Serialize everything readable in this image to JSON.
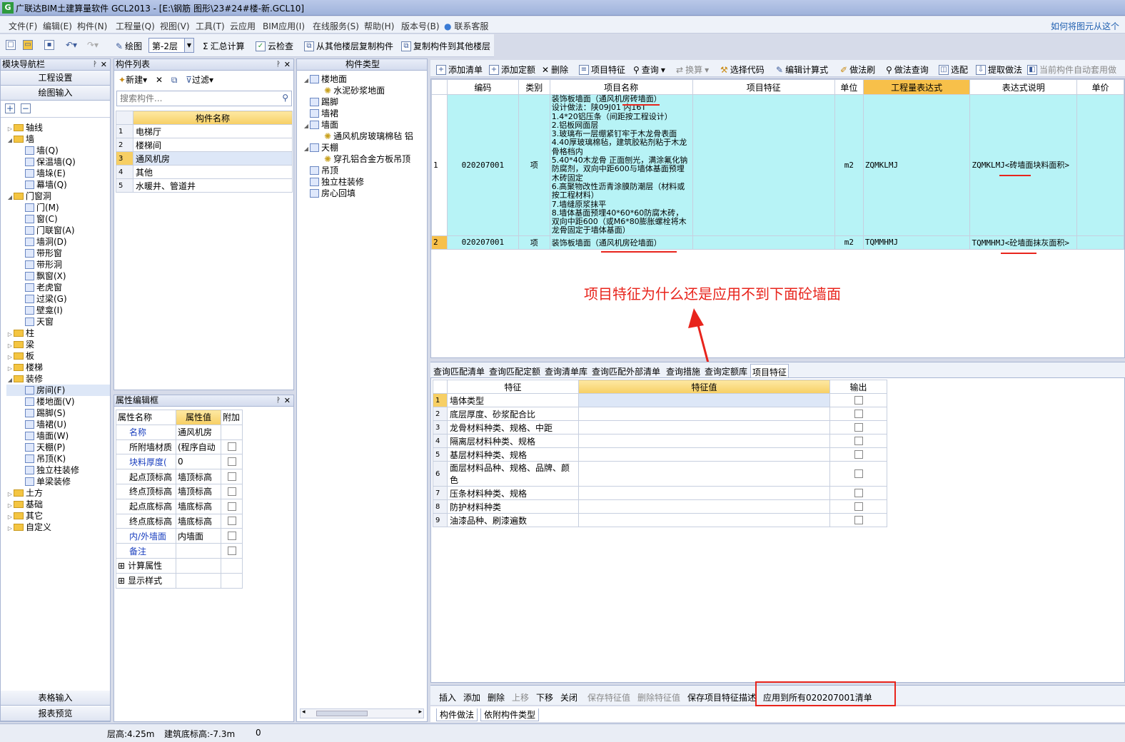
{
  "window": {
    "title": "广联达BIM土建算量软件 GCL2013 - [E:\\钢筋 图形\\23#24#楼-新.GCL10]",
    "app_icon_letter": "G"
  },
  "menu": {
    "items": [
      "文件(F)",
      "编辑(E)",
      "构件(N)",
      "工程量(Q)",
      "视图(V)",
      "工具(T)",
      "云应用",
      "BIM应用(I)",
      "在线服务(S)",
      "帮助(H)",
      "版本号(B)",
      "联系客服"
    ],
    "help_link": "如何将图元从这个"
  },
  "toolbar": {
    "draw": "绘图",
    "floor": "第-2层",
    "sum_calc": "汇总计算",
    "cloud_check": "云检查",
    "copy_from_floor": "从其他楼层复制构件",
    "copy_to_floor": "复制构件到其他楼层"
  },
  "nav": {
    "title": "模块导航栏",
    "buttons": {
      "project_settings": "工程设置",
      "draw_input": "绘图输入",
      "table_input": "表格输入",
      "report_preview": "报表预览"
    },
    "tree": [
      {
        "label": "轴线",
        "level": 0,
        "type": "folder",
        "exp": "+"
      },
      {
        "label": "墙",
        "level": 0,
        "type": "folder",
        "exp": "-"
      },
      {
        "label": "墙(Q)",
        "level": 1,
        "type": "leaf"
      },
      {
        "label": "保温墙(Q)",
        "level": 1,
        "type": "leaf"
      },
      {
        "label": "墙垛(E)",
        "level": 1,
        "type": "leaf"
      },
      {
        "label": "幕墙(Q)",
        "level": 1,
        "type": "leaf"
      },
      {
        "label": "门窗洞",
        "level": 0,
        "type": "folder",
        "exp": "-"
      },
      {
        "label": "门(M)",
        "level": 1,
        "type": "leaf"
      },
      {
        "label": "窗(C)",
        "level": 1,
        "type": "leaf"
      },
      {
        "label": "门联窗(A)",
        "level": 1,
        "type": "leaf"
      },
      {
        "label": "墙洞(D)",
        "level": 1,
        "type": "leaf"
      },
      {
        "label": "带形窗",
        "level": 1,
        "type": "leaf"
      },
      {
        "label": "带形洞",
        "level": 1,
        "type": "leaf"
      },
      {
        "label": "飘窗(X)",
        "level": 1,
        "type": "leaf"
      },
      {
        "label": "老虎窗",
        "level": 1,
        "type": "leaf"
      },
      {
        "label": "过梁(G)",
        "level": 1,
        "type": "leaf"
      },
      {
        "label": "壁龛(I)",
        "level": 1,
        "type": "leaf"
      },
      {
        "label": "天窗",
        "level": 1,
        "type": "leaf"
      },
      {
        "label": "柱",
        "level": 0,
        "type": "folder",
        "exp": "+"
      },
      {
        "label": "梁",
        "level": 0,
        "type": "folder",
        "exp": "+"
      },
      {
        "label": "板",
        "level": 0,
        "type": "folder",
        "exp": "+"
      },
      {
        "label": "楼梯",
        "level": 0,
        "type": "folder",
        "exp": "+"
      },
      {
        "label": "装修",
        "level": 0,
        "type": "folder",
        "exp": "-"
      },
      {
        "label": "房间(F)",
        "level": 1,
        "type": "leaf",
        "selected": true
      },
      {
        "label": "楼地面(V)",
        "level": 1,
        "type": "leaf"
      },
      {
        "label": "踢脚(S)",
        "level": 1,
        "type": "leaf"
      },
      {
        "label": "墙裙(U)",
        "level": 1,
        "type": "leaf"
      },
      {
        "label": "墙面(W)",
        "level": 1,
        "type": "leaf"
      },
      {
        "label": "天棚(P)",
        "level": 1,
        "type": "leaf"
      },
      {
        "label": "吊顶(K)",
        "level": 1,
        "type": "leaf"
      },
      {
        "label": "独立柱装修",
        "level": 1,
        "type": "leaf"
      },
      {
        "label": "单梁装修",
        "level": 1,
        "type": "leaf"
      },
      {
        "label": "土方",
        "level": 0,
        "type": "folder",
        "exp": "+"
      },
      {
        "label": "基础",
        "level": 0,
        "type": "folder",
        "exp": "+"
      },
      {
        "label": "其它",
        "level": 0,
        "type": "folder",
        "exp": "+"
      },
      {
        "label": "自定义",
        "level": 0,
        "type": "folder",
        "exp": "+"
      }
    ]
  },
  "component_list": {
    "title": "构件列表",
    "new": "新建",
    "filter": "过滤",
    "search_placeholder": "搜索构件...",
    "header": "构件名称",
    "rows": [
      {
        "n": "1",
        "name": "电梯厅"
      },
      {
        "n": "2",
        "name": "楼梯间"
      },
      {
        "n": "3",
        "name": "通风机房"
      },
      {
        "n": "4",
        "name": "其他"
      },
      {
        "n": "5",
        "name": "水暖井、管道井"
      }
    ]
  },
  "properties": {
    "title": "属性编辑框",
    "headers": [
      "属性名称",
      "属性值",
      "附加"
    ],
    "rows": [
      {
        "name": "名称",
        "value": "通风机房",
        "blue": true,
        "check": false
      },
      {
        "name": "所附墙材质",
        "value": "(程序自动",
        "blue": false,
        "check": true
      },
      {
        "name": "块料厚度(",
        "value": "0",
        "blue": true,
        "check": true
      },
      {
        "name": "起点顶标高",
        "value": "墙顶标高",
        "blue": false,
        "check": true
      },
      {
        "name": "终点顶标高",
        "value": "墙顶标高",
        "blue": false,
        "check": true
      },
      {
        "name": "起点底标高",
        "value": "墙底标高",
        "blue": false,
        "check": true
      },
      {
        "name": "终点底标高",
        "value": "墙底标高",
        "blue": false,
        "check": true
      },
      {
        "name": "内/外墙面",
        "value": "内墙面",
        "blue": true,
        "check": true
      },
      {
        "name": "备注",
        "value": "",
        "blue": true,
        "check": true
      },
      {
        "name": "计算属性",
        "value": "",
        "blue": false,
        "check": false,
        "expander": true
      },
      {
        "name": "显示样式",
        "value": "",
        "blue": false,
        "check": false,
        "expander": true
      }
    ]
  },
  "component_types": {
    "title": "构件类型",
    "tree": [
      {
        "label": "楼地面",
        "level": 0
      },
      {
        "label": "水泥砂浆地面",
        "level": 1
      },
      {
        "label": "踢脚",
        "level": 0
      },
      {
        "label": "墙裙",
        "level": 0
      },
      {
        "label": "墙面",
        "level": 0
      },
      {
        "label": "通风机房玻璃棉毡 铝",
        "level": 1
      },
      {
        "label": "天棚",
        "level": 0
      },
      {
        "label": "穿孔铝合金方板吊顶",
        "level": 1
      },
      {
        "label": "吊顶",
        "level": 0
      },
      {
        "label": "独立柱装修",
        "level": 0
      },
      {
        "label": "房心回填",
        "level": 0
      }
    ]
  },
  "main_toolbar": [
    "添加清单",
    "添加定额",
    "删除",
    "项目特征",
    "查询",
    "换算",
    "选择代码",
    "编辑计算式",
    "做法刷",
    "做法查询",
    "选配",
    "提取做法",
    "当前构件自动套用做"
  ],
  "bill": {
    "headers": [
      "编码",
      "类别",
      "项目名称",
      "项目特征",
      "单位",
      "工程量表达式",
      "表达式说明",
      "单价"
    ],
    "rows": [
      {
        "n": "1",
        "code": "020207001",
        "kind": "项",
        "name": "装饰板墙面（通风机房砖墙面）\n设计做法：陕09J01 内16T\n1.4*20铝压条（间距按工程设计）\n2.铝板网面层\n3.玻璃布一层绷紧钉牢于木龙骨表面\n4.40厚玻璃棉毡，建筑胶粘剂粘于木龙骨格档内\n5.40*40木龙骨 正面刨光，满涂氟化钠防腐剂，双向中距600与墙体基面预埋木砖固定\n6.高聚物改性沥青涂膜防潮层（材料或按工程材料）\n7.墙缝原浆抹平\n8.墙体基面预埋40*60*60防腐木砖，双向中距600（或M6*80膨胀螺栓将木龙骨固定于墙体基面）",
        "feature": "",
        "unit": "m2",
        "expr": "ZQMKLMJ",
        "expr_desc": "ZQMKLMJ<砖墙面块料面积>"
      },
      {
        "n": "2",
        "code": "020207001",
        "kind": "项",
        "name": "装饰板墙面（通风机房砼墙面）",
        "feature": "",
        "unit": "m2",
        "expr": "TQMMHMJ",
        "expr_desc": "TQMMHMJ<砼墙面抹灰面积>"
      }
    ]
  },
  "annotation": "项目特征为什么还是应用不到下面砼墙面",
  "tabs": [
    "查询匹配清单",
    "查询匹配定额",
    "查询清单库",
    "查询匹配外部清单",
    "查询措施",
    "查询定额库",
    "项目特征"
  ],
  "features": {
    "headers": [
      "特征",
      "特征值",
      "输出"
    ],
    "rows": [
      {
        "n": "1",
        "name": "墙体类型"
      },
      {
        "n": "2",
        "name": "底层厚度、砂浆配合比"
      },
      {
        "n": "3",
        "name": "龙骨材料种类、规格、中距"
      },
      {
        "n": "4",
        "name": "隔离层材料种类、规格"
      },
      {
        "n": "5",
        "name": "基层材料种类、规格"
      },
      {
        "n": "6",
        "name": "面层材料品种、规格、品牌、颜色"
      },
      {
        "n": "7",
        "name": "压条材料种类、规格"
      },
      {
        "n": "8",
        "name": "防护材料种类"
      },
      {
        "n": "9",
        "name": "油漆品种、刷漆遍数"
      }
    ]
  },
  "bottom_bar": {
    "insert": "插入",
    "add": "添加",
    "delete": "删除",
    "up": "上移",
    "down": "下移",
    "close": "关闭",
    "save_values": "保存特征值",
    "delete_values": "删除特征值",
    "save_desc": "保存项目特征描述",
    "apply_all": "应用到所有020207001清单"
  },
  "bottom_tabs": [
    "构件做法",
    "依附构件类型"
  ],
  "status": {
    "floor_height": "层高:4.25m",
    "base_elev": "建筑底标高:-7.3m",
    "zero": "0"
  },
  "colors": {
    "accent": "#f7c04a",
    "cyan_row": "#b7f3f6",
    "annotation_red": "#e8241c"
  }
}
